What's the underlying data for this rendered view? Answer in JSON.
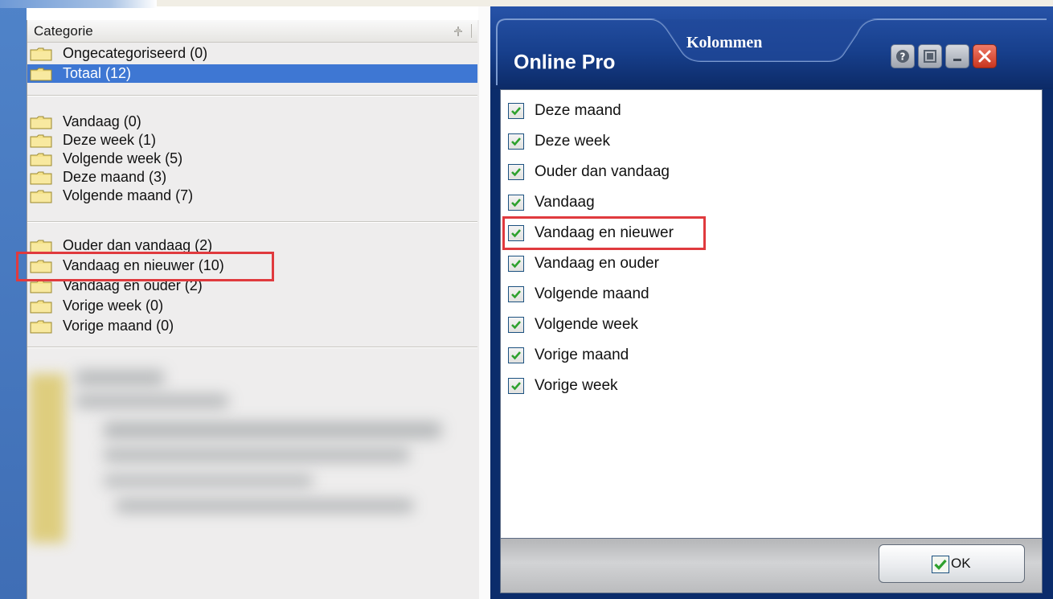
{
  "category_panel": {
    "header": "Categorie",
    "group1": [
      {
        "label": "Ongecategoriseerd (0)",
        "selected": false
      },
      {
        "label": "Totaal (12)",
        "selected": true
      }
    ],
    "group2": [
      {
        "label": "Vandaag (0)"
      },
      {
        "label": "Deze week (1)"
      },
      {
        "label": "Volgende week (5)"
      },
      {
        "label": "Deze maand (3)"
      },
      {
        "label": "Volgende maand (7)"
      }
    ],
    "group3": [
      {
        "label": "Ouder dan vandaag (2)"
      },
      {
        "label": "Vandaag en nieuwer (10)"
      },
      {
        "label": "Vandaag en ouder (2)"
      },
      {
        "label": "Vorige week (0)"
      },
      {
        "label": "Vorige maand (0)"
      }
    ],
    "highlighted": "Vandaag en nieuwer (10)"
  },
  "dialog": {
    "app_title": "Online Pro",
    "tab_label": "Kolommen",
    "buttons": [
      "help-icon",
      "screen-icon",
      "minimize-icon",
      "close-icon"
    ],
    "columns": [
      {
        "label": "Deze maand",
        "checked": true
      },
      {
        "label": "Deze week",
        "checked": true
      },
      {
        "label": "Ouder dan vandaag",
        "checked": true
      },
      {
        "label": "Vandaag",
        "checked": true
      },
      {
        "label": "Vandaag en nieuwer",
        "checked": true
      },
      {
        "label": "Vandaag en ouder",
        "checked": true
      },
      {
        "label": "Volgende maand",
        "checked": true
      },
      {
        "label": "Volgende week",
        "checked": true
      },
      {
        "label": "Vorige maand",
        "checked": true
      },
      {
        "label": "Vorige week",
        "checked": true
      }
    ],
    "highlighted": "Vandaag en nieuwer",
    "ok_label": "OK"
  },
  "colors": {
    "selection": "#3e77d3",
    "highlight_border": "#e03a3e",
    "dialog_title_bg": "#173f8c",
    "check_green": "#2ea12e"
  }
}
